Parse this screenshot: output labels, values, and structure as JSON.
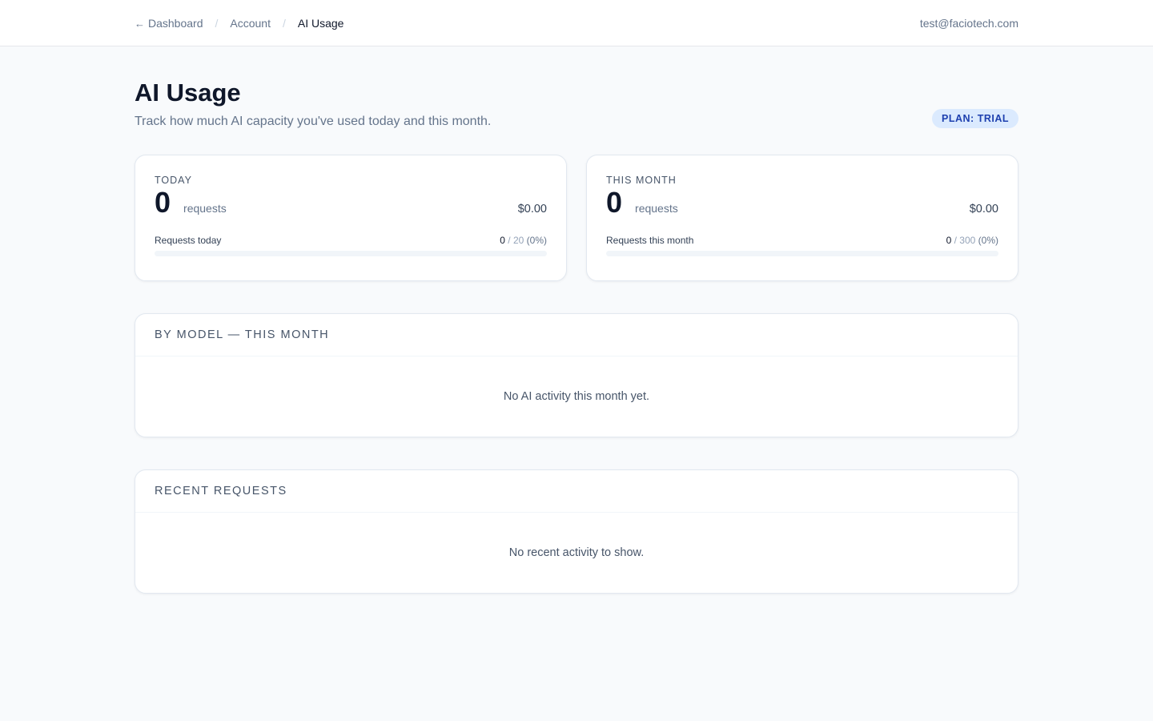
{
  "breadcrumb": {
    "items": [
      {
        "label": "Dashboard",
        "icon": "arrow-left-icon"
      },
      {
        "label": "Account"
      },
      {
        "label": "AI Usage"
      }
    ],
    "separator": "/"
  },
  "user": {
    "email": "test@faciotech.com"
  },
  "page": {
    "title": "AI Usage",
    "subtitle": "Track how much AI capacity you've used today and this month.",
    "plan_badge": "PLAN: TRIAL"
  },
  "cards": [
    {
      "label": "TODAY",
      "count": "0",
      "unit": "requests",
      "cost": "$0.00",
      "meter_label": "Requests today",
      "used": "0",
      "limit": "/ 20",
      "percent": "(0%)",
      "fill_fraction": 0
    },
    {
      "label": "THIS MONTH",
      "count": "0",
      "unit": "requests",
      "cost": "$0.00",
      "meter_label": "Requests this month",
      "used": "0",
      "limit": "/ 300",
      "percent": "(0%)",
      "fill_fraction": 0
    }
  ],
  "by_model": {
    "title": "BY MODEL — THIS MONTH",
    "empty_text": "No AI activity this month yet."
  },
  "recent": {
    "title": "RECENT REQUESTS",
    "empty_text": "No recent activity to show."
  },
  "colors": {
    "accent": "#3b82f6",
    "badge_bg": "#dbeafe",
    "badge_text": "#1e40af"
  }
}
